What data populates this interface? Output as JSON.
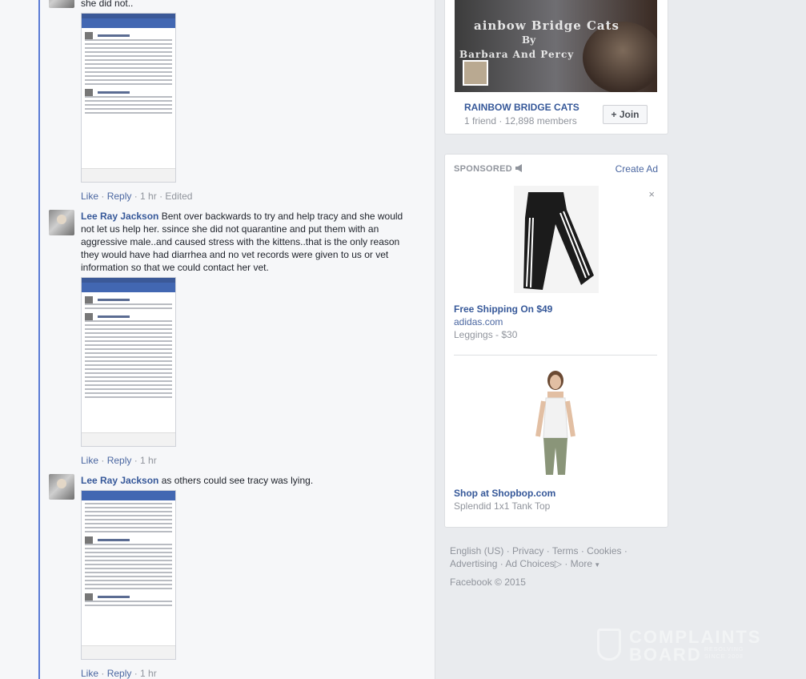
{
  "feed": {
    "partial_text": "she did not..",
    "comments": [
      {
        "actions": {
          "like": "Like",
          "reply": "Reply",
          "time": "1 hr",
          "edited": "Edited"
        }
      },
      {
        "author": "Lee Ray Jackson",
        "text": "Bent over backwards to try and help tracy and she would not let us help her. ssince she did not quarantine and put them with an aggressive male..and caused stress with the kittens..that is the only reason they would have had diarrhea and no vet records were given to us or vet information so that we could contact her vet.",
        "actions": {
          "like": "Like",
          "reply": "Reply",
          "time": "1 hr"
        }
      },
      {
        "author": "Lee Ray Jackson",
        "text": "as others could see tracy was lying.",
        "actions": {
          "like": "Like",
          "reply": "Reply",
          "time": "1 hr"
        }
      }
    ]
  },
  "group_card": {
    "banner_line1": "ainbow Bridge Cats",
    "banner_line2": "By",
    "banner_line3": "Barbara And Percy",
    "name": "RAINBOW BRIDGE CATS",
    "meta": "1 friend · 12,898 members",
    "join_label": "Join",
    "join_icon": "plus-icon"
  },
  "ads": {
    "sponsored_label": "SPONSORED",
    "sponsored_icon": "megaphone-icon",
    "create_ad_label": "Create Ad",
    "close_glyph": "×",
    "items": [
      {
        "title": "Free Shipping On $49",
        "domain": "adidas.com",
        "desc": "Leggings - $30"
      },
      {
        "title": "Shop at Shopbop.com",
        "domain": "",
        "desc": "Splendid 1x1 Tank Top"
      }
    ]
  },
  "footer": {
    "links": [
      "English (US)",
      "Privacy",
      "Terms",
      "Cookies",
      "Advertising",
      "Ad Choices",
      "More"
    ],
    "copyright": "Facebook © 2015"
  },
  "watermark": {
    "line1": "COMPLAINTS",
    "line2": "BOARD",
    "tag1": "RESOLVING",
    "tag2": "SINCE 2008"
  },
  "colors": {
    "link": "#4b67a1",
    "author": "#365899",
    "thread_line": "#5b7bd5",
    "muted": "#90949c"
  }
}
